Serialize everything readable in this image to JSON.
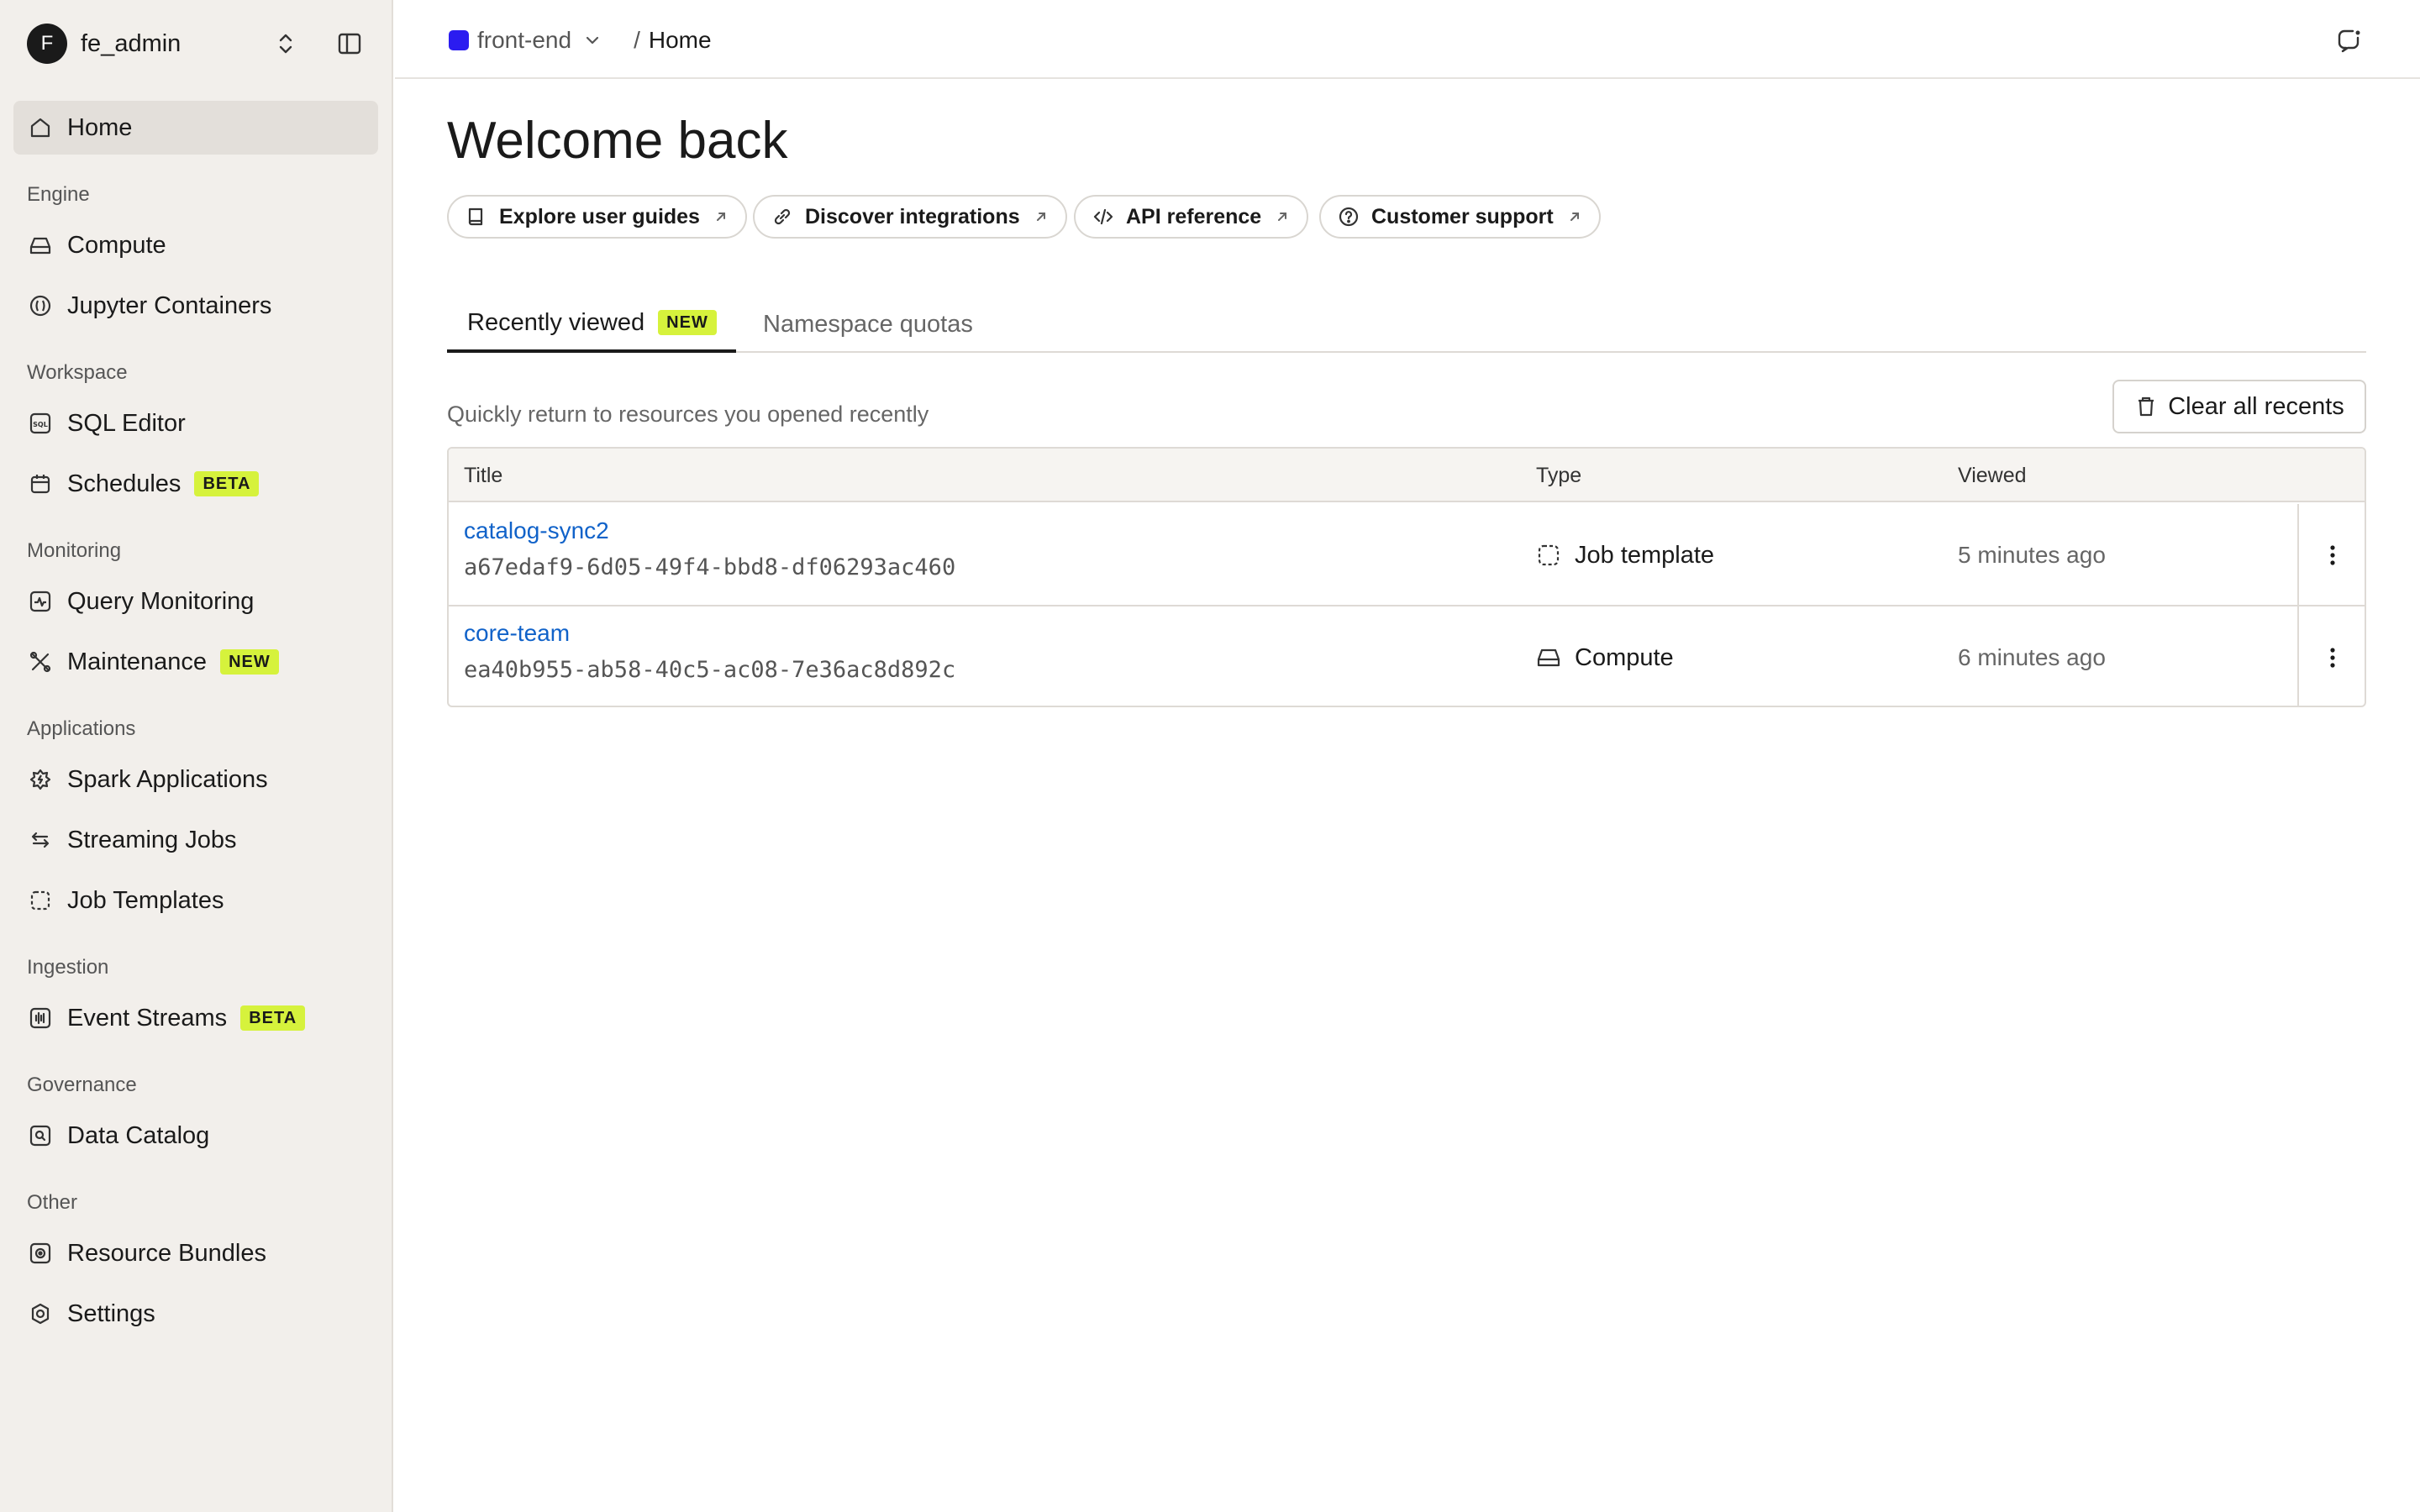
{
  "workspace": {
    "initial": "F",
    "name": "fe_admin"
  },
  "sidebar": {
    "home": "Home",
    "sections": {
      "engine": "Engine",
      "workspace": "Workspace",
      "monitoring": "Monitoring",
      "applications": "Applications",
      "ingestion": "Ingestion",
      "governance": "Governance",
      "other": "Other"
    },
    "items": {
      "compute": "Compute",
      "jupyter": "Jupyter Containers",
      "sql_editor": "SQL Editor",
      "schedules": "Schedules",
      "schedules_badge": "BETA",
      "query_monitoring": "Query Monitoring",
      "maintenance": "Maintenance",
      "maintenance_badge": "NEW",
      "spark_apps": "Spark Applications",
      "streaming_jobs": "Streaming Jobs",
      "job_templates": "Job Templates",
      "event_streams": "Event Streams",
      "event_streams_badge": "BETA",
      "data_catalog": "Data Catalog",
      "resource_bundles": "Resource Bundles",
      "settings": "Settings"
    }
  },
  "topbar": {
    "project": "front-end",
    "separator": "/",
    "current": "Home"
  },
  "main": {
    "title": "Welcome back",
    "quick_links": {
      "guides": "Explore user guides",
      "integrations": "Discover integrations",
      "api": "API reference",
      "support": "Customer support"
    },
    "tabs": {
      "recent": "Recently viewed",
      "recent_badge": "NEW",
      "quotas": "Namespace quotas"
    },
    "subtitle": "Quickly return to resources you opened recently",
    "clear_button": "Clear all recents",
    "table": {
      "headers": {
        "title": "Title",
        "type": "Type",
        "viewed": "Viewed"
      },
      "rows": [
        {
          "title": "catalog-sync2",
          "id": "a67edaf9-6d05-49f4-bbd8-df06293ac460",
          "type": "Job template",
          "viewed": "5 minutes ago"
        },
        {
          "title": "core-team",
          "id": "ea40b955-ab58-40c5-ac08-7e36ac8d892c",
          "type": "Compute",
          "viewed": "6 minutes ago"
        }
      ]
    }
  },
  "colors": {
    "accent_badge": "#d6f23c",
    "project_swatch": "#2b1cf0",
    "link": "#1062c9",
    "sidebar_bg": "#f2efeb"
  }
}
